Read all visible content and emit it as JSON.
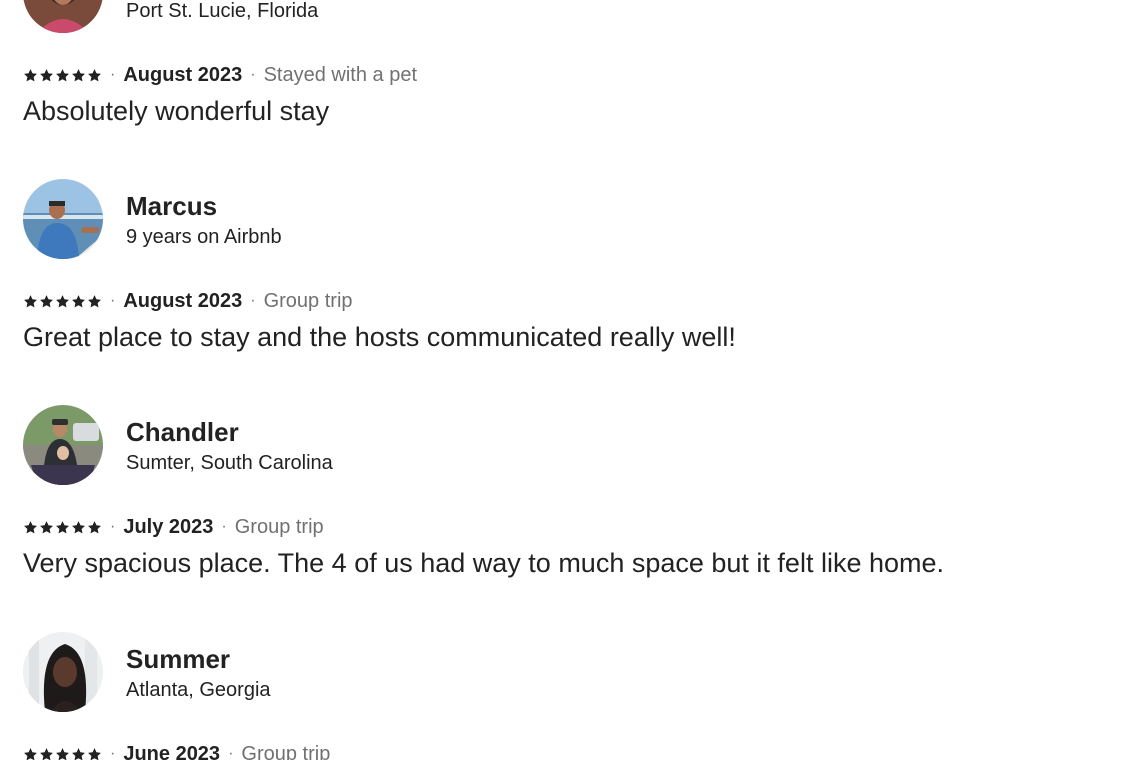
{
  "reviews": [
    {
      "name": "",
      "subtitle": "Port St. Lucie, Florida",
      "rating": 5,
      "date": "August 2023",
      "trip_type": "Stayed with a pet",
      "text": "Absolutely wonderful stay"
    },
    {
      "name": "Marcus",
      "subtitle": "9 years on Airbnb",
      "rating": 5,
      "date": "August 2023",
      "trip_type": "Group trip",
      "text": "Great place to stay and the hosts communicated really well!"
    },
    {
      "name": "Chandler",
      "subtitle": "Sumter, South Carolina",
      "rating": 5,
      "date": "July 2023",
      "trip_type": "Group trip",
      "text": "Very spacious place. The 4 of us had way to much space but it felt like home."
    },
    {
      "name": "Summer",
      "subtitle": "Atlanta, Georgia",
      "rating": 5,
      "date": "June 2023",
      "trip_type": "Group trip",
      "text": ""
    }
  ],
  "separator": "·",
  "colors": {
    "text": "#222222",
    "muted": "#717171",
    "star": "#222222"
  }
}
